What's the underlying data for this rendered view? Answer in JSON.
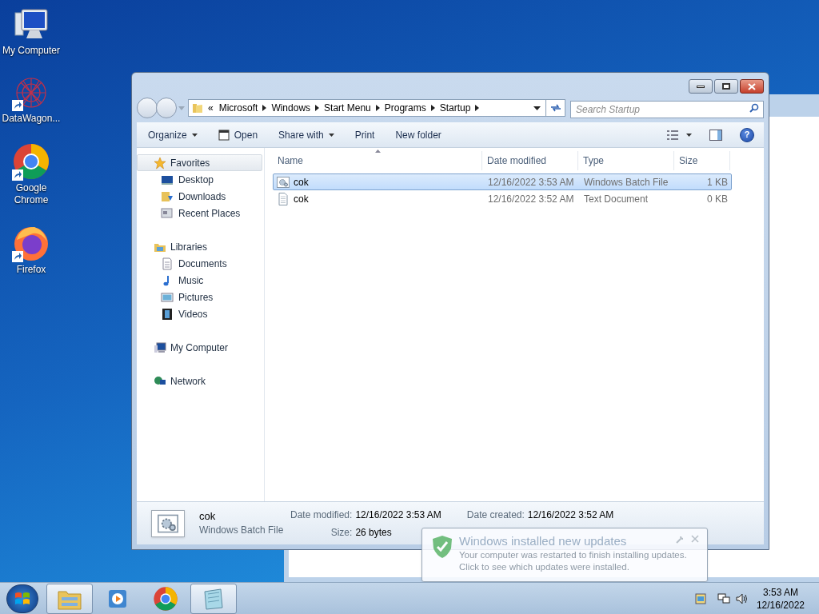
{
  "desktop_icons": [
    {
      "label": "My Computer",
      "kind": "computer",
      "shortcut": false
    },
    {
      "label": "DataWagon...",
      "kind": "datawagon",
      "shortcut": true
    },
    {
      "label": "Google Chrome",
      "kind": "chrome",
      "shortcut": true
    },
    {
      "label": "Firefox",
      "kind": "firefox",
      "shortcut": true
    }
  ],
  "explorer": {
    "breadcrumb_overflow": "«",
    "help_label": "?",
    "breadcrumb": [
      "Microsoft",
      "Windows",
      "Start Menu",
      "Programs",
      "Startup"
    ],
    "search": {
      "placeholder": "Search Startup"
    },
    "toolbar": [
      {
        "label": "Organize",
        "kind": "menu"
      },
      {
        "label": "Open",
        "kind": "icon"
      },
      {
        "label": "Share with",
        "kind": "menu"
      },
      {
        "label": "Print",
        "kind": "plain"
      },
      {
        "label": "New folder",
        "kind": "plain"
      }
    ],
    "nav": [
      {
        "label": "Favorites",
        "selected": true,
        "children": [
          {
            "label": "Desktop",
            "selected": false
          },
          {
            "label": "Downloads",
            "selected": false
          },
          {
            "label": "Recent Places",
            "selected": false
          }
        ]
      },
      {
        "label": "Libraries",
        "selected": false,
        "children": [
          {
            "label": "Documents",
            "selected": false
          },
          {
            "label": "Music",
            "selected": false
          },
          {
            "label": "Pictures",
            "selected": false
          },
          {
            "label": "Videos",
            "selected": false
          }
        ]
      },
      {
        "label": "My Computer",
        "selected": false
      },
      {
        "label": "Network",
        "selected": false
      }
    ],
    "columns": [
      "Name",
      "Date modified",
      "Type",
      "Size"
    ],
    "rows": [
      {
        "name": "cok",
        "date": "12/16/2022 3:53 AM",
        "type": "Windows Batch File",
        "size": "1 KB",
        "selected": true
      },
      {
        "name": "cok",
        "date": "12/16/2022 3:52 AM",
        "type": "Text Document",
        "size": "0 KB",
        "selected": false
      }
    ],
    "details": {
      "name": "cok",
      "type": "Windows Batch File",
      "fields": [
        {
          "label": "Date modified:",
          "value": "12/16/2022 3:53 AM"
        },
        {
          "label": "Size:",
          "value": "26 bytes"
        },
        {
          "label": "Date created:",
          "value": "12/16/2022 3:52 AM"
        }
      ]
    }
  },
  "notification": {
    "title": "Windows installed new updates",
    "lines": [
      "Your computer was restarted to finish installing updates.",
      "Click to see which updates were installed."
    ]
  },
  "taskbar": {
    "items": [
      {
        "kind": "explorer",
        "running": true
      },
      {
        "kind": "media",
        "running": false
      },
      {
        "kind": "chrome",
        "running": false
      },
      {
        "kind": "notepad",
        "running": true
      }
    ],
    "time": "3:53 AM",
    "date": "12/16/2022"
  }
}
